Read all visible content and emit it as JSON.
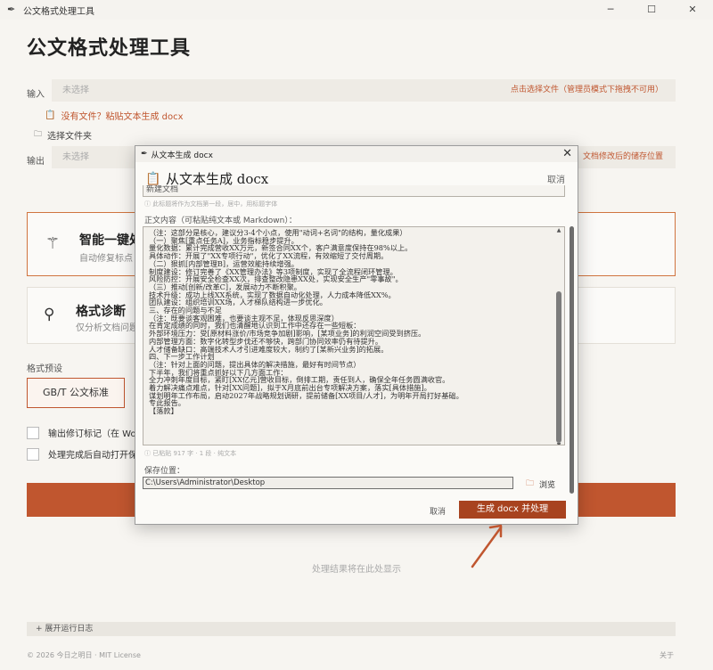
{
  "window": {
    "title": "公文格式处理工具",
    "min": "─",
    "max": "☐",
    "close": "✕"
  },
  "main": {
    "title": "公文格式处理工具",
    "input_label": "输入",
    "input_value": "未选择",
    "input_hint": "点击选择文件（管理员模式下拖拽不可用）",
    "paste_link": "没有文件？粘贴文本生成 docx",
    "folder_link": "选择文件夹",
    "output_label": "输出",
    "output_value": "未选择",
    "output_hint": "文档修改后的储存位置",
    "card1_title": "智能一键处",
    "card1_sub": "自动修复标点",
    "card2_title": "格式诊断",
    "card2_sub": "仅分析文档问题",
    "preset_label": "格式预设",
    "preset_value": "GB/T 公文标准",
    "check1": "输出修订标记（在 Wo",
    "check2": "处理完成后自动打开保",
    "result_hint": "处理结果将在此处显示",
    "log_label": "+   展开运行日志",
    "footer_left": "© 2026 今日之明日 · MIT License",
    "footer_right": "关于"
  },
  "modal": {
    "window_title": "从文本生成 docx",
    "heading": "从文本生成 docx",
    "cancel_top": "取消",
    "title_value": "新建文档",
    "title_hint": "ⓘ 此标题将作为文档第一段，居中，用标题字体",
    "body_label": "正文内容（可粘贴纯文本或 Markdown）：",
    "body_text": "（注：这部分是核心，建议分3-4个小点，使用\"动词+名词\"的结构，量化成果）\n（一）聚焦[重点任务A]，业务指标稳步提升。\n量化数据：累计完成营收XX万元，新签合同XX个，客户满意度保持在98%以上。\n具体动作：开展了\"XX专项行动\"，优化了XX流程，有效缩短了交付周期。\n（二）狠抓[内部管理B]，运营效能持续增强。\n制度建设：修订完善了《XX管理办法》等3项制度，实现了全流程闭环管理。\n风险防控：开展安全检查XX次，排查整改隐患XX处，实现安全生产\"零事故\"。\n（三）推动[创新/改革C]，发展动力不断积聚。\n技术升级：成功上线XX系统，实现了数据自动化处理，人力成本降低XX%。\n团队建设：组织培训XX场，人才梯队结构进一步优化。\n三、存在的问题与不足\n（注：既要谈客观困难，也要谈主观不足，体现反思深度）\n在肯定成绩的同时，我们也清醒地认识到工作中还存在一些短板：\n外部环境压力：受[原材料涨价/市场竞争加剧]影响，[某项业务]的利润空间受到挤压。\n内部管理方面：数字化转型步伐还不够快，跨部门协同效率仍有待提升。\n人才储备缺口：高端技术人才引进难度较大，制约了[某新兴业务]的拓展。\n四、下一步工作计划\n（注：针对上面的问题，提出具体的解决措施，最好有时间节点）\n下半年，我们将重点抓好以下几方面工作：\n全力冲刺年度目标，紧盯[XX亿元]营收目标，倒排工期，责任到人，确保全年任务圆满收官。\n着力解决痛点难点，针对[XX问题]，拟于X月底前出台专项解决方案，落实[具体措施]。\n谋划明年工作布局，启动2027年战略规划调研，提前储备[XX项目/人才]，为明年开局打好基础。\n专此报告。\n【落款】",
    "stats": "ⓘ 已粘贴 917 字 · 1 段 · 纯文本",
    "save_label": "保存位置：",
    "save_path": "C:\\Users\\Administrator\\Desktop",
    "browse_label": "浏览",
    "cancel": "取消",
    "submit": "生成 docx 并处理"
  },
  "colors": {
    "accent": "#c0562f",
    "submit": "#a8431f",
    "annotation_arrow": "#c0562f"
  }
}
